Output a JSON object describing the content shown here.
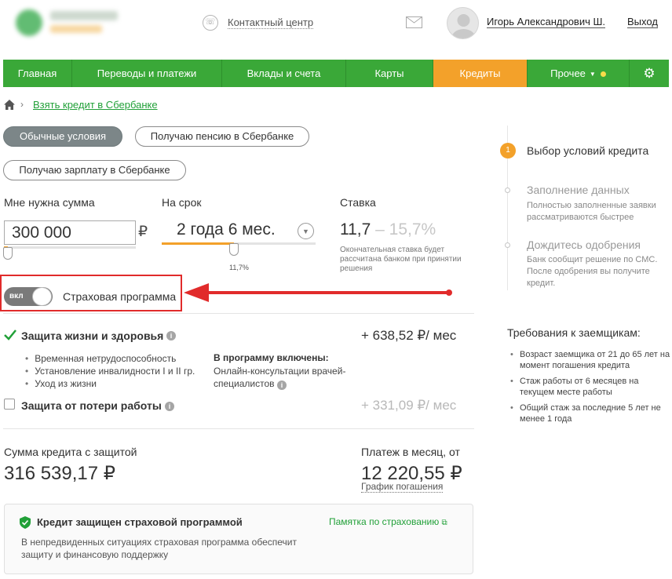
{
  "header": {
    "contact_label": "Контактный центр",
    "user_name": "Игорь Александрович Ш.",
    "logout_label": "Выход"
  },
  "nav": {
    "items": [
      "Главная",
      "Переводы и платежи",
      "Вклады и счета",
      "Карты",
      "Кредиты",
      "Прочее"
    ],
    "active": "Кредиты"
  },
  "breadcrumb": {
    "link": "Взять кредит в Сбербанке"
  },
  "conditions": {
    "options": [
      "Обычные условия",
      "Получаю пенсию в Сбербанке",
      "Получаю зарплату в Сбербанке"
    ],
    "selected": "Обычные условия"
  },
  "calculator": {
    "amount_label": "Мне нужна сумма",
    "amount_value": "300 000",
    "currency": "₽",
    "amount_slider_level": 0.03,
    "term_label": "На срок",
    "term_value": "2 года 6 мес.",
    "term_slider_level": 0.47,
    "term_tick": "11,7%",
    "rate_label": "Ставка",
    "rate_value": "11,7",
    "rate_range": "– 15,7%",
    "rate_note": "Окончательная ставка будет рассчитана банком при принятии решения"
  },
  "insurance": {
    "toggle_label": "вкл",
    "toggle_on": true,
    "program_label": "Страховая программа",
    "life": {
      "title": "Защита жизни и здоровья",
      "checked": true,
      "price": "+ 638,52 ₽/ мес",
      "items": [
        "Временная нетрудоспособность",
        "Установление инвалидности I и II гр.",
        "Уход из жизни"
      ],
      "included_title": "В программу включены:",
      "included_text": "Онлайн-консультации врачей-специалистов"
    },
    "job": {
      "title": "Защита от потери работы",
      "checked": false,
      "price": "+ 331,09 ₽/ мес"
    }
  },
  "summary": {
    "credit_label": "Сумма кредита с защитой",
    "credit_value": "316 539,17 ₽",
    "payment_label": "Платеж в месяц, от",
    "payment_value": "12 220,55 ₽",
    "schedule_link": "График погашения"
  },
  "protect": {
    "title": "Кредит защищен страховой программой",
    "memo_link": "Памятка по страхованию",
    "text": "В непредвиденных ситуациях страховая программа обеспечит защиту и финансовую поддержку"
  },
  "steps": [
    {
      "number": "1",
      "title": "Выбор условий кредита",
      "desc": ""
    },
    {
      "number": "",
      "title": "Заполнение данных",
      "desc": "Полностью заполненные заявки рассматриваются быстрее"
    },
    {
      "number": "",
      "title": "Дождитесь одобрения",
      "desc": "Банк сообщит решение по СМС. После одобрения вы получите кредит."
    }
  ],
  "requirements": {
    "title": "Требования к заемщикам:",
    "items": [
      "Возраст заемщика от 21 до 65 лет на момент погашения кредита",
      "Стаж работы от 6 месяцев на текущем месте работы",
      "Общий стаж за последние 5 лет не менее 1 года"
    ]
  },
  "colors": {
    "brand_green": "#3aa838",
    "active_orange": "#f3a12a",
    "link_green": "#21a038",
    "highlight_red": "#e12b2b"
  }
}
